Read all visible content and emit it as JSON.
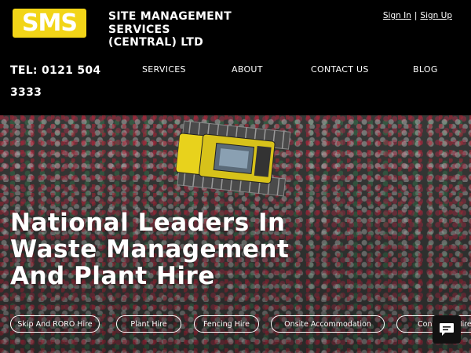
{
  "brand": {
    "logo_text": "SMS",
    "company_name": "SITE MANAGEMENT SERVICES (CENTRAL) LTD"
  },
  "auth": {
    "sign_in": "Sign In",
    "separator": "|",
    "sign_up": "Sign Up"
  },
  "contact": {
    "tel": "TEL: 0121 504 3333"
  },
  "nav": {
    "services": "SERVICES",
    "about": "ABOUT",
    "contact": "CONTACT US",
    "blog": "BLOG"
  },
  "hero": {
    "headline_line1": "National Leaders In",
    "headline_line2": "Waste Management",
    "headline_line3": "And Plant Hire"
  },
  "services": [
    {
      "label": "Skip And RORO Hire"
    },
    {
      "label": "Plant Hire"
    },
    {
      "label": "Fencing Hire"
    },
    {
      "label": "Onsite Accommodation"
    },
    {
      "label": "Container Hire"
    }
  ],
  "colors": {
    "logo_yellow": "#f2d518",
    "header_bg": "#000000"
  },
  "icons": {
    "chat": "chat-icon"
  }
}
